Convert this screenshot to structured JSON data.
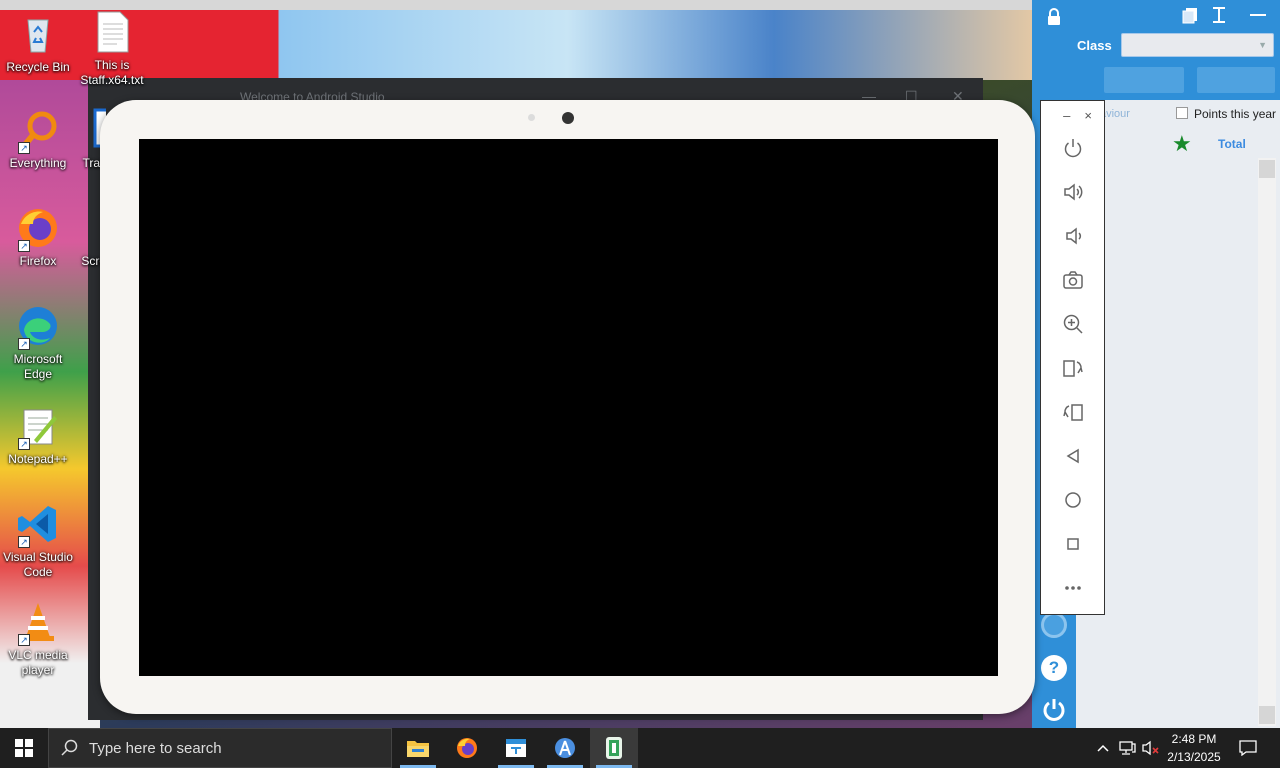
{
  "desktop": {
    "icons": [
      {
        "label": "Recycle Bin",
        "icon": "recycle-bin-icon"
      },
      {
        "label": "This is Staff.x64.txt",
        "icon": "text-file-icon"
      },
      {
        "label": "Everything",
        "icon": "everything-search-icon"
      },
      {
        "label": "Trac",
        "icon": "app-icon"
      },
      {
        "label": "Firefox",
        "icon": "firefox-icon"
      },
      {
        "label": "Scre",
        "icon": "app-icon"
      },
      {
        "label": "Microsoft Edge",
        "icon": "edge-icon"
      },
      {
        "label": "Notepad++",
        "icon": "notepadpp-icon"
      },
      {
        "label": "Visual Studio Code",
        "icon": "vscode-icon"
      },
      {
        "label": "VLC media player",
        "icon": "vlc-icon"
      }
    ],
    "background_window_title": "Welcome to Android Studio"
  },
  "emulator": {
    "toolbar_buttons": [
      {
        "name": "power",
        "icon": "power-icon"
      },
      {
        "name": "volume-up",
        "icon": "volume-up-icon"
      },
      {
        "name": "volume-down",
        "icon": "volume-down-icon"
      },
      {
        "name": "screenshot",
        "icon": "camera-icon"
      },
      {
        "name": "zoom",
        "icon": "zoom-in-icon"
      },
      {
        "name": "rotate-left",
        "icon": "rotate-left-icon"
      },
      {
        "name": "rotate-right",
        "icon": "rotate-right-icon"
      },
      {
        "name": "back",
        "icon": "back-triangle-icon"
      },
      {
        "name": "home",
        "icon": "home-circle-icon"
      },
      {
        "name": "overview",
        "icon": "overview-square-icon"
      },
      {
        "name": "more",
        "icon": "more-dots-icon"
      }
    ],
    "minimize_glyph": "–",
    "close_glyph": "×"
  },
  "side_app": {
    "class_label": "Class",
    "class_value": "",
    "behaviour_fragment": "aviour",
    "points_label": "Points this year",
    "total_label": "Total",
    "accent": "#2f8fd8"
  },
  "taskbar": {
    "search_placeholder": "Type here to search",
    "time": "2:48 PM",
    "date": "2/13/2025",
    "apps": [
      "file-explorer-icon",
      "firefox-icon",
      "class-app-icon",
      "android-studio-icon",
      "emulator-icon"
    ]
  }
}
